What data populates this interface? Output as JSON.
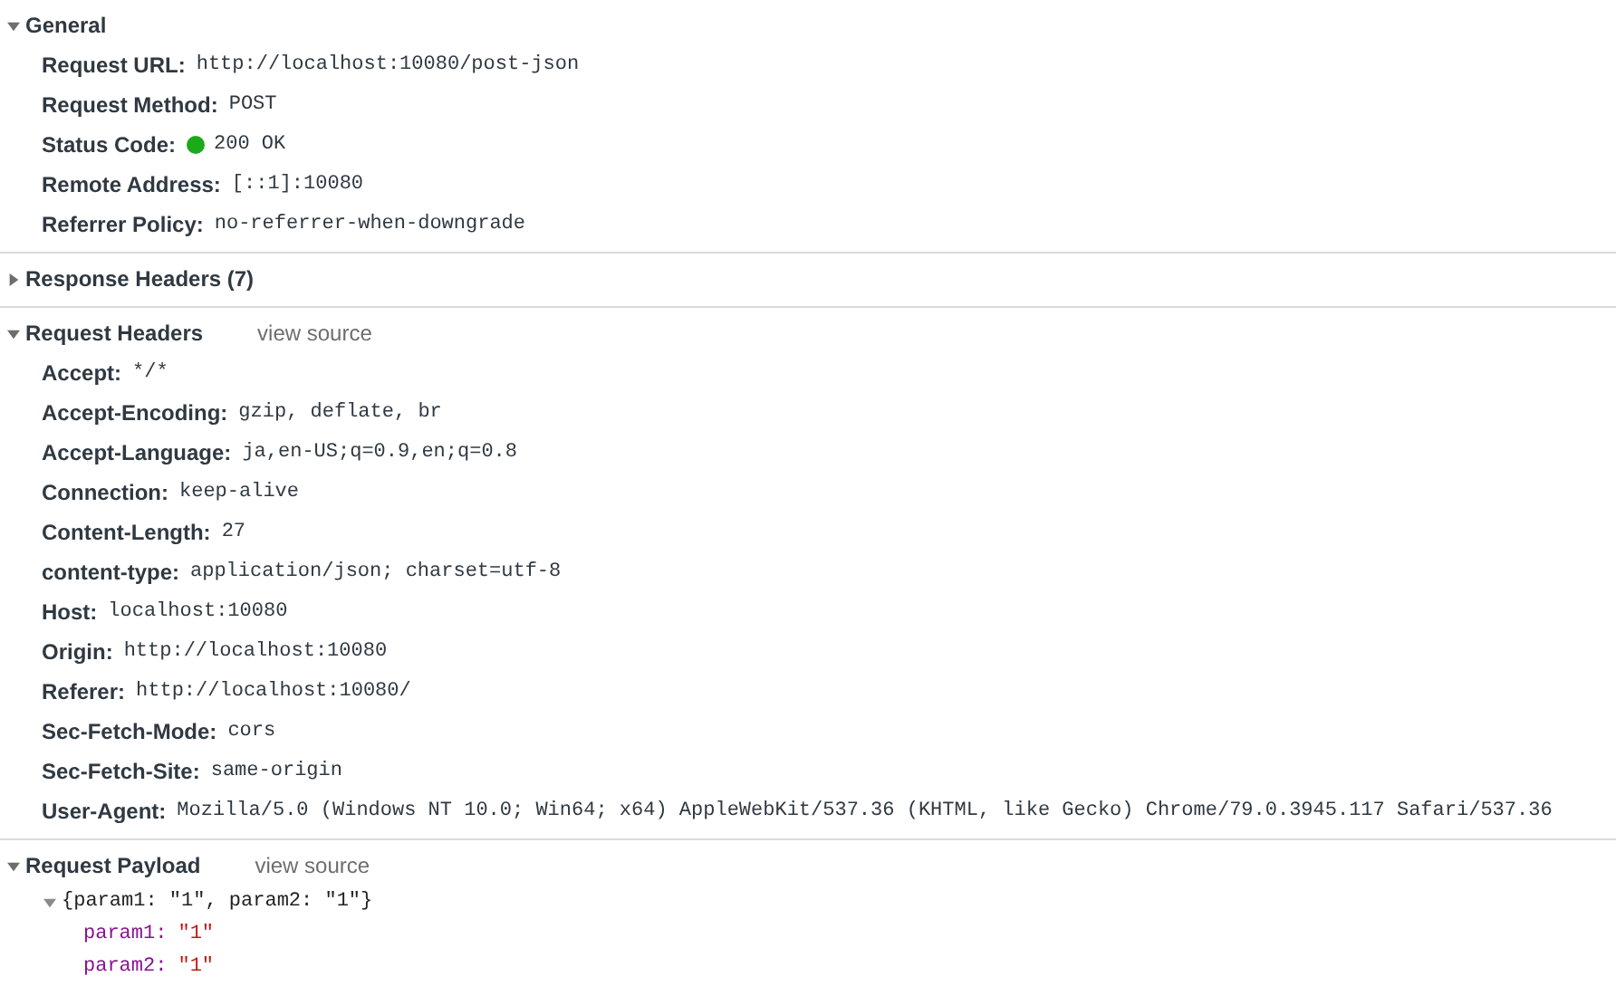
{
  "sections": [
    {
      "title": "General",
      "expanded": true,
      "rows": [
        {
          "name": "Request URL:",
          "value": "http://localhost:10080/post-json"
        },
        {
          "name": "Request Method:",
          "value": "POST"
        },
        {
          "name": "Status Code:",
          "value": "200 OK",
          "color": "#1aaa1a"
        },
        {
          "name": "Remote Address:",
          "value": "[::1]:10080"
        },
        {
          "name": "Referrer Policy:",
          "value": "no-referrer-when-downgrade"
        }
      ]
    },
    {
      "title": "Response Headers (7)",
      "expanded": false
    },
    {
      "title": "Request Headers",
      "expanded": true,
      "view_source": "view source",
      "rows": [
        {
          "name": "Accept:",
          "value": "*/*"
        },
        {
          "name": "Accept-Encoding:",
          "value": "gzip, deflate, br"
        },
        {
          "name": "Accept-Language:",
          "value": "ja,en-US;q=0.9,en;q=0.8"
        },
        {
          "name": "Connection:",
          "value": "keep-alive"
        },
        {
          "name": "Content-Length:",
          "value": "27"
        },
        {
          "name": "content-type:",
          "value": "application/json; charset=utf-8"
        },
        {
          "name": "Host:",
          "value": "localhost:10080"
        },
        {
          "name": "Origin:",
          "value": "http://localhost:10080"
        },
        {
          "name": "Referer:",
          "value": "http://localhost:10080/"
        },
        {
          "name": "Sec-Fetch-Mode:",
          "value": "cors"
        },
        {
          "name": "Sec-Fetch-Site:",
          "value": "same-origin"
        },
        {
          "name": "User-Agent:",
          "value": "Mozilla/5.0 (Windows NT 10.0; Win64; x64) AppleWebKit/537.36 (KHTML, like Gecko) Chrome/79.0.3945.117 Safari/537.36"
        }
      ]
    },
    {
      "title": "Request Payload",
      "expanded": true,
      "view_source": "view source",
      "payload": {
        "summary": "{param1: \"1\", param2: \"1\"}",
        "expanded": true,
        "children": [
          {
            "key": "param1:",
            "value": "\"1\""
          },
          {
            "key": "param2:",
            "value": "\"1\""
          }
        ]
      }
    }
  ]
}
